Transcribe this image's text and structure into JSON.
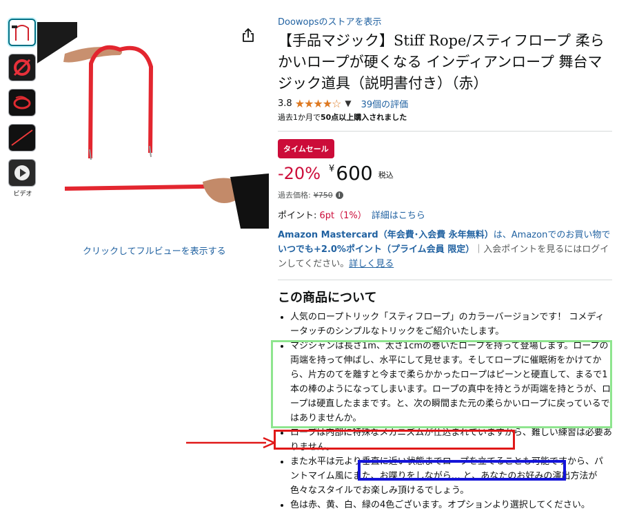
{
  "thumbnails": [
    {
      "name": "thumb-rope-arch",
      "active": true
    },
    {
      "name": "thumb-rope-coil-red",
      "active": false
    },
    {
      "name": "thumb-rope-coil-dark",
      "active": false
    },
    {
      "name": "thumb-rope-straight",
      "active": false
    },
    {
      "name": "thumb-video",
      "active": false
    }
  ],
  "video_label": "ビデオ",
  "fullview_link": "クリックしてフルビューを表示する",
  "store_link": "Doowopsのストアを表示",
  "title": "【手品マジック】Stiff Rope/スティフロープ 柔らかいロープが硬くなる インディアンロープ 舞台マジック道具（説明書付き）（赤）",
  "rating": {
    "value": "3.8",
    "stars": "★★★★☆",
    "reviews": "39個の評価"
  },
  "bought": {
    "prefix": "過去1か月で",
    "bold": "50点以上購入されました"
  },
  "sale_badge": "タイムセール",
  "price": {
    "discount": "-20%",
    "currency": "¥",
    "amount": "600",
    "tax": "税込",
    "old_label": "過去価格:",
    "old_price": "¥750"
  },
  "points": {
    "label": "ポイント:",
    "value": "6pt（1%）",
    "link": "詳細はこちら"
  },
  "mastercard": {
    "link": "Amazon Mastercard（年会費･入会費 永年無料）",
    "mid": "は、Amazonでのお買い物で",
    "bold": "いつでも+2.0%ポイント（プライム会員 限定）",
    "tail": "｜入会ポイントを見るにはログインしてください。",
    "detail": "詳しく見る"
  },
  "about": {
    "title": "この商品について",
    "bullets": [
      "人気のロープトリック「スティフロープ」のカラーバージョンです！ コメディータッチのシンプルなトリックをご紹介いたします。",
      "マジシャンは長さ1m、太さ1cmの巻いたロープを持って登場します。ロープの両端を持って伸ばし、水平にして見せます。そしてロープに催眠術をかけてから、片方のてを離すと今まで柔らかかったロープはピーンと硬直して、まるで1本の棒のようになってしまいます。ロープの真中を持とうが両端を持とうが、ロープは硬直したままです。と、次の瞬間また元の柔らかいロープに戻っているではありませんか。",
      "ロープは内部に特殊なメカニズムが仕込まれていますから、難しい練習は必要ありません。",
      "また水平は元より垂直に近い状態までロープを立てることも可能ですから、パントマイム風にまた、お喋りをしながら… と、あなたのお好みの演出方法が色々なスタイルでお楽しみ頂けるでしょう。",
      "色は赤、黄、白、緑の4色ございます。オプションより選択してください。"
    ]
  },
  "colors": {
    "link": "#2162a1",
    "sale": "#cc0c39",
    "star": "#de7921",
    "annotation_green": "#8ee58e",
    "annotation_red": "#e01818",
    "annotation_blue": "#1414d8"
  }
}
